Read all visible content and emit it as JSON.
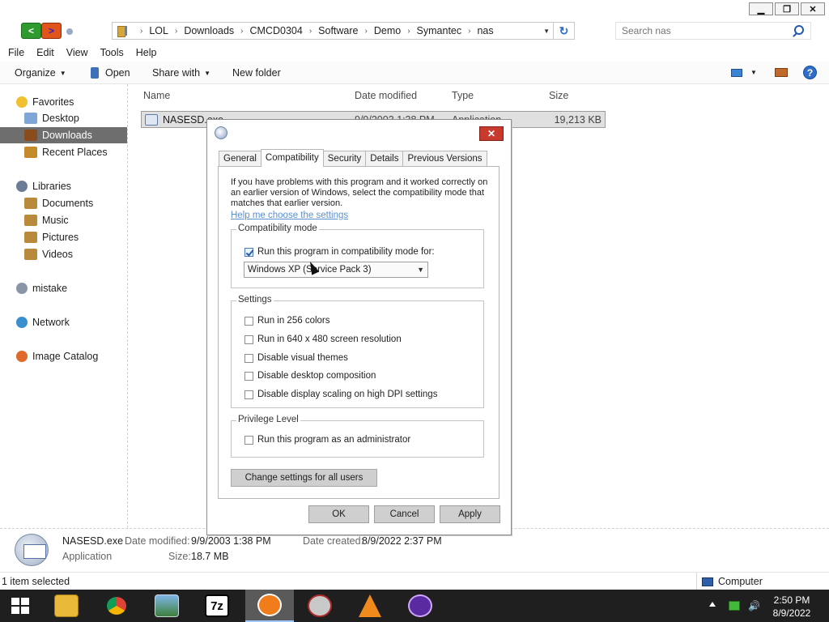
{
  "window": {
    "minimize_glyph": "▁",
    "maximize_glyph": "❐",
    "close_glyph": "✕"
  },
  "address": {
    "crumbs": [
      "LOL",
      "Downloads",
      "CMCD0304",
      "Software",
      "Demo",
      "Symantec",
      "nas"
    ],
    "separator": "›",
    "refresh_glyph": "↻"
  },
  "search": {
    "placeholder": "Search nas"
  },
  "menu": [
    "File",
    "Edit",
    "View",
    "Tools",
    "Help"
  ],
  "commands": {
    "organize": "Organize",
    "open": "Open",
    "share_with": "Share with",
    "new_folder": "New folder",
    "help_glyph": "?"
  },
  "nav_pane": {
    "favorites": "Favorites",
    "desktop": "Desktop",
    "downloads": "Downloads",
    "recent_places": "Recent Places",
    "libraries": "Libraries",
    "documents": "Documents",
    "music": "Music",
    "pictures": "Pictures",
    "videos": "Videos",
    "mistake": "mistake",
    "network": "Network",
    "image_catalog": "Image Catalog"
  },
  "file_list": {
    "columns": {
      "name": "Name",
      "date_modified": "Date modified",
      "type": "Type",
      "size": "Size"
    },
    "rows": [
      {
        "name": "NASESD.exe",
        "date_modified": "9/9/2003 1:38 PM",
        "type": "Application",
        "size": "19,213 KB"
      }
    ]
  },
  "details": {
    "file_name": "NASESD.exe",
    "file_type": "Application",
    "date_modified_label": "Date modified:",
    "date_modified": "9/9/2003 1:38 PM",
    "date_created_label": "Date created:",
    "date_created": "8/9/2022 2:37 PM",
    "size_label": "Size:",
    "size": "18.7 MB"
  },
  "status": {
    "selection": "1 item selected",
    "location": "Computer"
  },
  "dialog": {
    "tabs": [
      "General",
      "Compatibility",
      "Security",
      "Details",
      "Previous Versions"
    ],
    "active_tab": "Compatibility",
    "intro": "If you have problems with this program and it worked correctly on an earlier version of Windows, select the compatibility mode that matches that earlier version.",
    "help_link": "Help me choose the settings",
    "compat_group_title": "Compatibility mode",
    "compat_checkbox": {
      "label": "Run this program in compatibility mode for:",
      "checked": true
    },
    "compat_select": {
      "value": "Windows XP (Service Pack 3)"
    },
    "settings_group_title": "Settings",
    "settings": [
      {
        "label": "Run in 256 colors",
        "checked": false
      },
      {
        "label": "Run in 640 x 480 screen resolution",
        "checked": false
      },
      {
        "label": "Disable visual themes",
        "checked": false
      },
      {
        "label": "Disable desktop composition",
        "checked": false
      },
      {
        "label": "Disable display scaling on high DPI settings",
        "checked": false
      }
    ],
    "privilege_group_title": "Privilege Level",
    "privilege_checkbox": {
      "label": "Run this program as an administrator",
      "checked": false
    },
    "change_all_button": "Change settings for all users",
    "ok_button": "OK",
    "cancel_button": "Cancel",
    "apply_button": "Apply",
    "close_glyph": "✕"
  },
  "taskbar": {
    "apps": [
      "file-explorer",
      "chrome",
      "image-viewer",
      "7-zip",
      "power-app",
      "media-tool",
      "vlc",
      "media-player"
    ],
    "active_app": "power-app",
    "seven_zip_label": "7z",
    "time": "2:50 PM",
    "date": "8/9/2022"
  },
  "colors": {
    "selection_gray": "#6e6e6e",
    "dialog_close": "#c83a2e",
    "link": "#5a8fd0",
    "taskbar": "#1f1f1f"
  }
}
